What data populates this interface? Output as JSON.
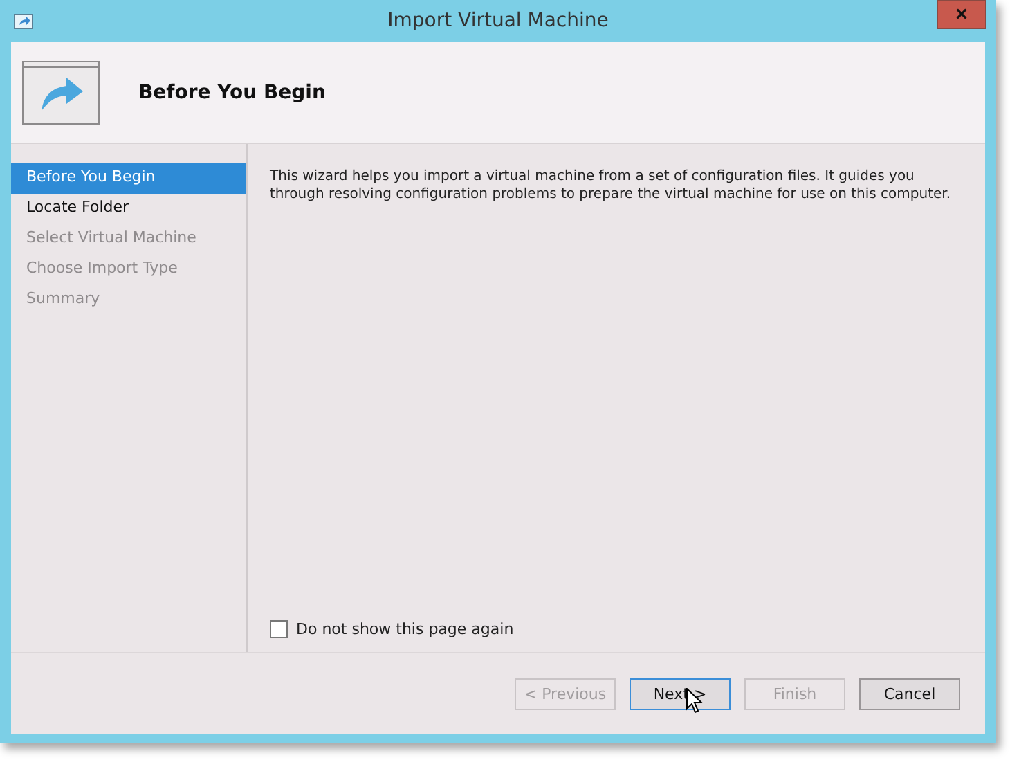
{
  "window": {
    "title": "Import Virtual Machine",
    "close": "×"
  },
  "header": {
    "title": "Before You Begin"
  },
  "steps": [
    {
      "label": "Before You Begin",
      "selected": true,
      "disabled": false
    },
    {
      "label": "Locate Folder",
      "selected": false,
      "disabled": false
    },
    {
      "label": "Select Virtual Machine",
      "selected": false,
      "disabled": true
    },
    {
      "label": "Choose Import Type",
      "selected": false,
      "disabled": true
    },
    {
      "label": "Summary",
      "selected": false,
      "disabled": true
    }
  ],
  "description": "This wizard helps you import a virtual machine from a set of configuration files. It guides you through resolving configuration problems to prepare the virtual machine for use on this computer.",
  "dont_show_again": {
    "label": "Do not show this page again",
    "checked": false
  },
  "buttons": [
    {
      "label": "< Previous",
      "disabled": true,
      "focused": false
    },
    {
      "label": "Next >",
      "disabled": false,
      "focused": true
    },
    {
      "label": "Finish",
      "disabled": true,
      "focused": false
    },
    {
      "label": "Cancel",
      "disabled": false,
      "focused": false
    }
  ]
}
